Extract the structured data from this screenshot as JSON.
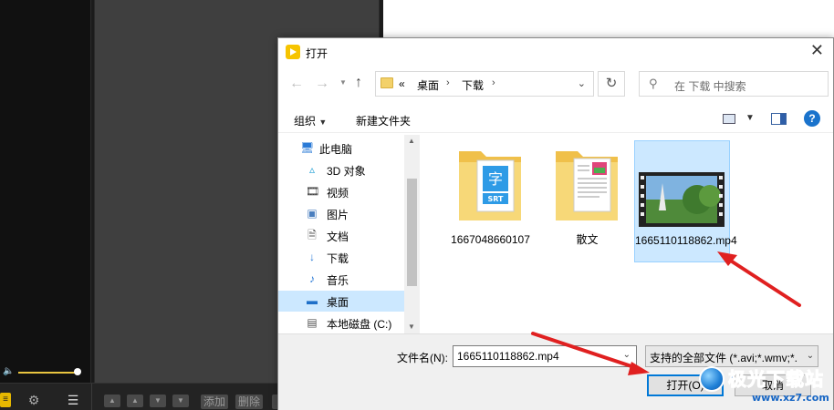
{
  "background_app": {
    "bottom_buttons": {
      "add": "添加",
      "delete": "删除"
    }
  },
  "dialog": {
    "title": "打开",
    "breadcrumb": {
      "overflow": "«",
      "items": [
        "桌面",
        "下载"
      ]
    },
    "search_placeholder": "在 下载 中搜索",
    "toolbar": {
      "organize": "组织",
      "new_folder": "新建文件夹"
    },
    "nav_items": [
      {
        "label": "此电脑",
        "icon": "computer-icon"
      },
      {
        "label": "3D 对象",
        "icon": "3d-objects-icon"
      },
      {
        "label": "视频",
        "icon": "video-icon"
      },
      {
        "label": "图片",
        "icon": "pictures-icon"
      },
      {
        "label": "文档",
        "icon": "documents-icon"
      },
      {
        "label": "下载",
        "icon": "download-icon"
      },
      {
        "label": "音乐",
        "icon": "music-icon"
      },
      {
        "label": "桌面",
        "icon": "desktop-icon",
        "selected": true
      },
      {
        "label": "本地磁盘 (C:)",
        "icon": "drive-icon"
      }
    ],
    "files": [
      {
        "name": "1667048660107",
        "type": "folder",
        "badge_char": "字",
        "badge_text": "SRT"
      },
      {
        "name": "散文",
        "type": "folder"
      },
      {
        "name": "1665110118862.mp4",
        "type": "video",
        "selected": true
      }
    ],
    "filename_label": "文件名(N):",
    "filename_value": "1665110118862.mp4",
    "filetype_value": "支持的全部文件 (*.avi;*.wmv;*.",
    "open_button": "打开(O)",
    "cancel_button": "取消"
  },
  "watermark": {
    "name": "极光下载站",
    "url": "www.xz7.com"
  },
  "colors": {
    "accent": "#0078d7",
    "selection": "#cce8ff",
    "arrow": "#e02020",
    "player_accent": "#e8c440"
  }
}
